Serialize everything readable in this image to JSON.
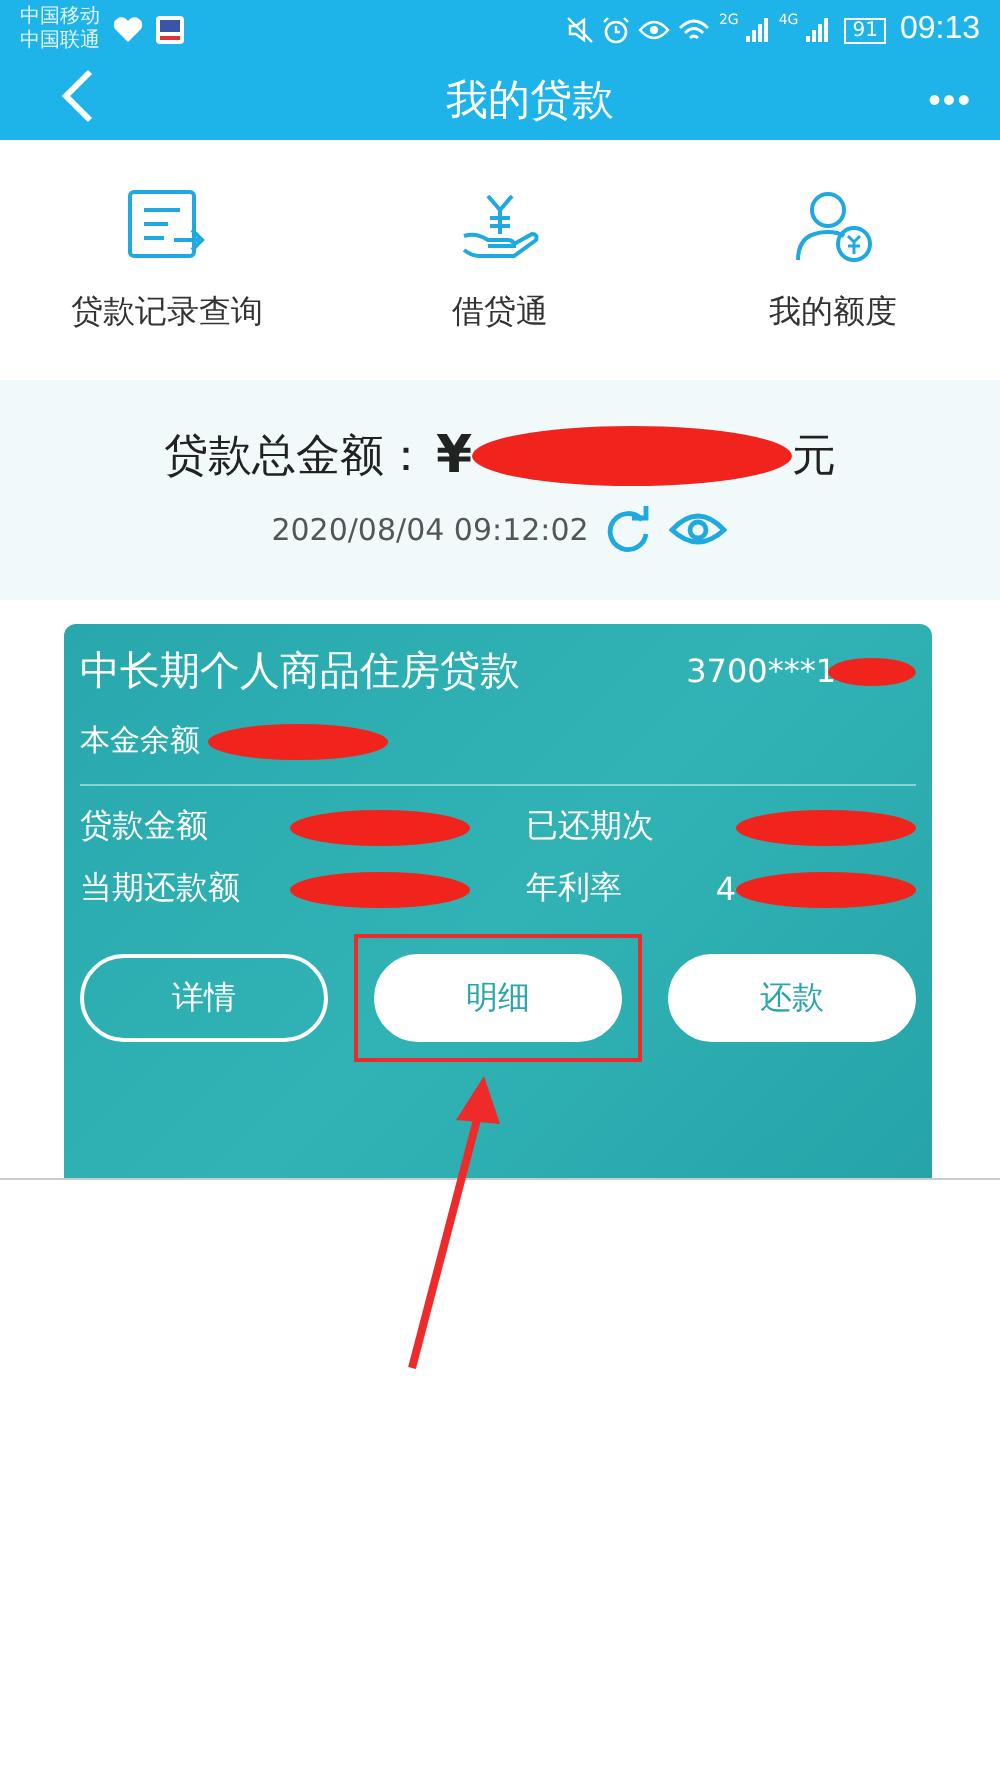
{
  "status_bar": {
    "carriers": [
      "中国移动",
      "中国联通"
    ],
    "network_labels": [
      "2G",
      "4G"
    ],
    "battery": "91",
    "time": "09:13"
  },
  "nav": {
    "title": "我的贷款",
    "more": "•••"
  },
  "shortcuts": [
    {
      "label": "贷款记录查询",
      "kind": "record"
    },
    {
      "label": "借贷通",
      "kind": "loan"
    },
    {
      "label": "我的额度",
      "kind": "quota"
    }
  ],
  "summary": {
    "label": "贷款总金额：",
    "currency": "¥",
    "unit": "元",
    "timestamp": "2020/08/04 09:12:02"
  },
  "loan_card": {
    "title": "中长期个人商品住房贷款",
    "account": "3700***1",
    "balance_label": "本金余额",
    "fields": [
      {
        "label": "贷款金额"
      },
      {
        "label": "已还期次"
      },
      {
        "label": "当期还款额"
      },
      {
        "label": "年利率",
        "value": "4"
      }
    ],
    "buttons": [
      {
        "label": "详情",
        "kind": "outline",
        "selected": false
      },
      {
        "label": "明细",
        "kind": "filled",
        "selected": true
      },
      {
        "label": "还款",
        "kind": "filled",
        "selected": false
      }
    ]
  }
}
